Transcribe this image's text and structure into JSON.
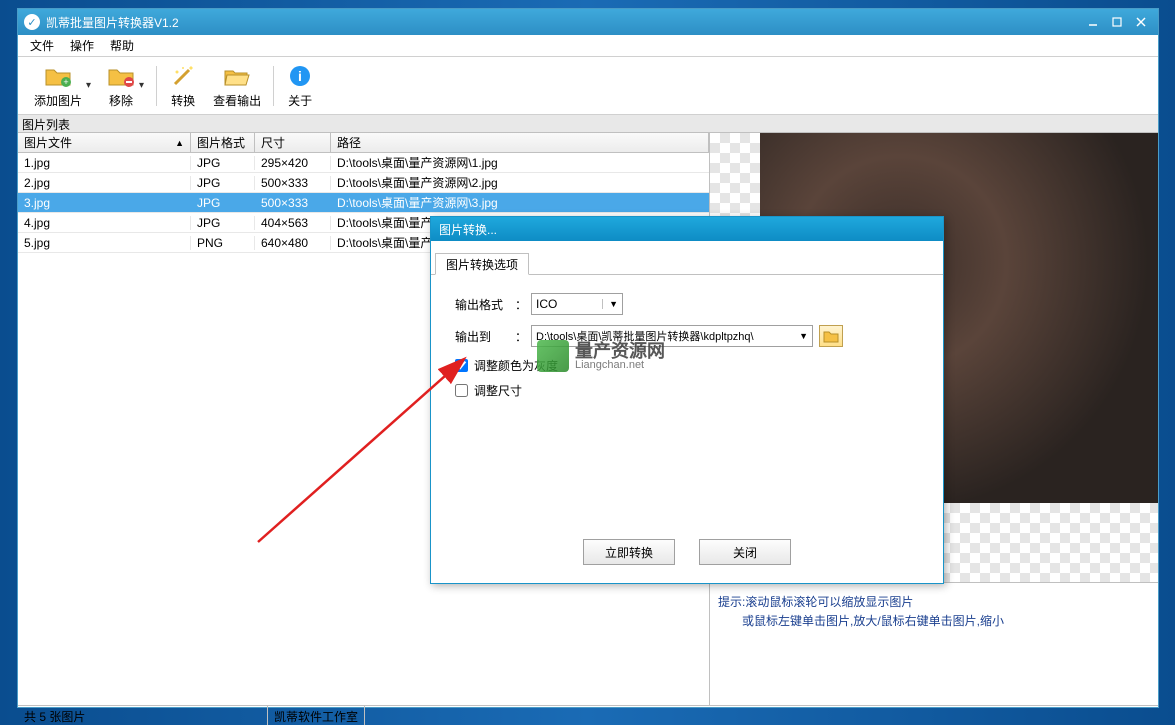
{
  "window": {
    "title": "凯蒂批量图片转换器V1.2"
  },
  "menu": {
    "file": "文件",
    "action": "操作",
    "help": "帮助"
  },
  "toolbar": {
    "add": "添加图片",
    "remove": "移除",
    "convert": "转换",
    "view_output": "查看输出",
    "about": "关于"
  },
  "list_panel_title": "图片列表",
  "columns": {
    "file": "图片文件",
    "format": "图片格式",
    "size": "尺寸",
    "path": "路径"
  },
  "rows": [
    {
      "file": "1.jpg",
      "format": "JPG",
      "size": "295×420",
      "path": "D:\\tools\\桌面\\量产资源网\\1.jpg",
      "selected": false
    },
    {
      "file": "2.jpg",
      "format": "JPG",
      "size": "500×333",
      "path": "D:\\tools\\桌面\\量产资源网\\2.jpg",
      "selected": false
    },
    {
      "file": "3.jpg",
      "format": "JPG",
      "size": "500×333",
      "path": "D:\\tools\\桌面\\量产资源网\\3.jpg",
      "selected": true
    },
    {
      "file": "4.jpg",
      "format": "JPG",
      "size": "404×563",
      "path": "D:\\tools\\桌面\\量产资源网\\4.jpg",
      "selected": false
    },
    {
      "file": "5.jpg",
      "format": "PNG",
      "size": "640×480",
      "path": "D:\\tools\\桌面\\量产资源网\\5.jpg",
      "selected": false
    }
  ],
  "hint": {
    "line1": "提示:滚动鼠标滚轮可以缩放显示图片",
    "line2": "或鼠标左键单击图片,放大/鼠标右键单击图片,缩小"
  },
  "status": {
    "count": "共 5 张图片",
    "vendor": "凯蒂软件工作室"
  },
  "dialog": {
    "title": "图片转换...",
    "tab": "图片转换选项",
    "output_format_label": "输出格式",
    "output_format_value": "ICO",
    "output_dir_label": "输出到",
    "output_dir_value": "D:\\tools\\桌面\\凯蒂批量图片转换器\\kdpltpzhq\\",
    "adjust_color": "调整颜色为灰度",
    "adjust_size": "调整尺寸",
    "convert_now": "立即转换",
    "close": "关闭"
  },
  "watermark": {
    "cn": "量产资源网",
    "en": "Liangchan.net"
  }
}
